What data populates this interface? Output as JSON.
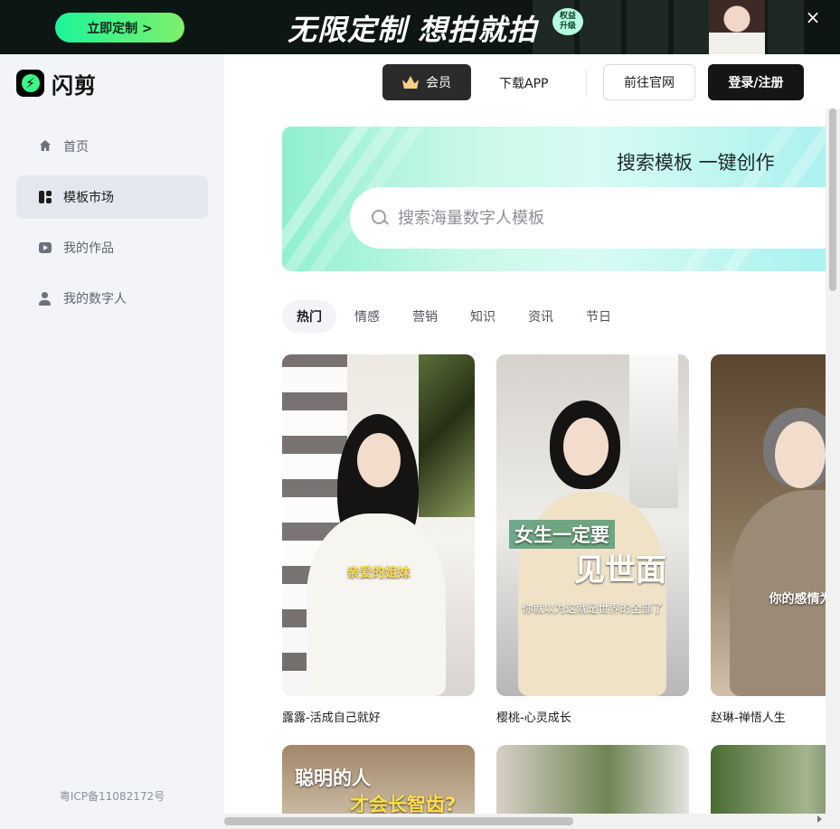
{
  "banner": {
    "button_label": "立即定制 >",
    "title": "无限定制 想拍就拍",
    "badge_line1": "权益",
    "badge_line2": "升级",
    "close_label": "×"
  },
  "brand": {
    "name": "闪剪",
    "logo_glyph": "⚡"
  },
  "sidebar": {
    "items": [
      {
        "label": "首页",
        "icon": "home-icon"
      },
      {
        "label": "模板市场",
        "icon": "template-grid-icon"
      },
      {
        "label": "我的作品",
        "icon": "video-play-icon"
      },
      {
        "label": "我的数字人",
        "icon": "digital-person-icon"
      }
    ],
    "icp": "粤ICP备11082172号"
  },
  "topbar": {
    "vip_label": "会员",
    "download_label": "下载APP",
    "official_label": "前往官网",
    "login_label": "登录/注册"
  },
  "hero": {
    "title": "搜索模板 一键创作",
    "search_placeholder": "搜索海量数字人模板"
  },
  "tabs": [
    "热门",
    "情感",
    "营销",
    "知识",
    "资讯",
    "节日"
  ],
  "cards": [
    {
      "title": "露露-活成自己就好",
      "caption": "亲爱的姐妹",
      "subcaption": ""
    },
    {
      "title": "樱桃-心灵成长",
      "caption": "女生一定要",
      "caption2": "见世面",
      "subcaption": "你就以为这就是世界的全部了"
    },
    {
      "title": "赵琳-禅悟人生",
      "caption": "",
      "subcaption": "你的感情为什"
    }
  ],
  "next_row": {
    "first_card_caption": "聪明的人",
    "first_card_caption2": "才会长智齿?"
  },
  "colors": {
    "accent_green": "#1cf49a",
    "dark_button": "#151515",
    "sidebar_bg": "#f3f4f8"
  }
}
